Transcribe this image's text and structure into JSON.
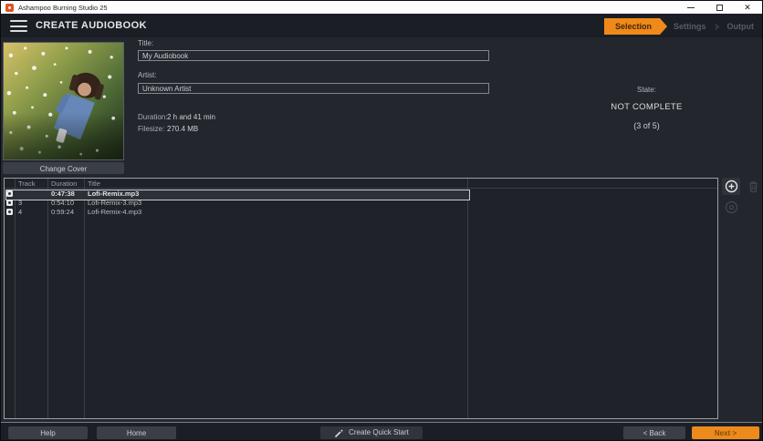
{
  "titlebar": {
    "app_title": "Ashampoo Burning Studio 25",
    "controls": {
      "minimize": "minimize",
      "maximize": "maximize",
      "close": "✕"
    }
  },
  "header": {
    "title": "CREATE AUDIOBOOK",
    "steps": [
      {
        "label": "Selection",
        "active": true
      },
      {
        "label": "Settings",
        "active": false
      },
      {
        "label": "Output",
        "active": false
      }
    ]
  },
  "cover": {
    "button_label": "Change Cover"
  },
  "form": {
    "title_label": "Title:",
    "title_value": "My Audiobook",
    "artist_label": "Artist:",
    "artist_value": "Unknown Artist",
    "duration_label": "Duration:",
    "duration_value": "2 h and 41 min",
    "filesize_label": "Filesize:",
    "filesize_value": "270.4 MB"
  },
  "state": {
    "label": "State:",
    "value": "NOT COMPLETE",
    "progress": "(3 of 5)"
  },
  "table": {
    "columns": [
      "Track",
      "Duration",
      "Title"
    ],
    "rows": [
      {
        "track": "",
        "duration": "0:47:38",
        "title": "Lofi-Remix.mp3",
        "selected": true
      },
      {
        "track": "3",
        "duration": "0:54:10",
        "title": "Lofi-Remix-3.mp3",
        "selected": false
      },
      {
        "track": "4",
        "duration": "0:59:24",
        "title": "Lofi-Remix-4.mp3",
        "selected": false
      }
    ]
  },
  "side_actions": {
    "add": "add-track",
    "remove": "remove-track",
    "disc": "disc"
  },
  "footer": {
    "help": "Help",
    "home": "Home",
    "quick_start": "Create Quick Start",
    "back": "< Back",
    "next": "Next >"
  },
  "colors": {
    "accent_orange": "#ef8a1a",
    "header_bg": "#1b1f25",
    "content_bg": "#23272d",
    "table_bg": "#1f2329",
    "selection_border": "#c9cdd3"
  }
}
